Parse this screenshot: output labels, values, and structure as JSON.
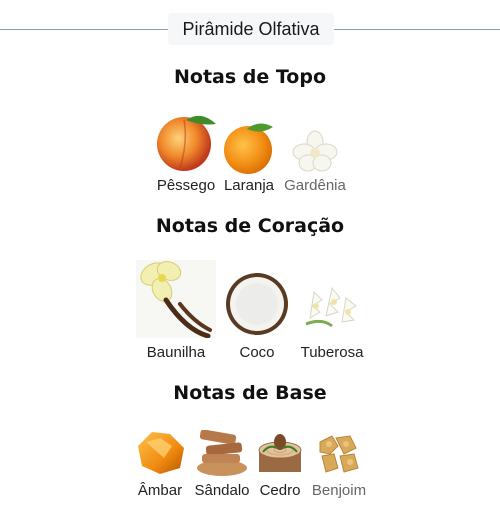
{
  "header": {
    "title": "Pirâmide Olfativa"
  },
  "sections": [
    {
      "title": "Notas de Topo",
      "notes": [
        {
          "label": "Pêssego",
          "icon": "peach-icon"
        },
        {
          "label": "Laranja",
          "icon": "orange-icon"
        },
        {
          "label": "Gardênia",
          "icon": "gardenia-icon"
        }
      ]
    },
    {
      "title": "Notas de Coração",
      "notes": [
        {
          "label": "Baunilha",
          "icon": "vanilla-icon"
        },
        {
          "label": "Coco",
          "icon": "coconut-icon"
        },
        {
          "label": "Tuberosa",
          "icon": "tuberose-icon"
        }
      ]
    },
    {
      "title": "Notas de Base",
      "notes": [
        {
          "label": "Âmbar",
          "icon": "amber-icon"
        },
        {
          "label": "Sândalo",
          "icon": "sandalwood-icon"
        },
        {
          "label": "Cedro",
          "icon": "cedar-icon"
        },
        {
          "label": "Benjoim",
          "icon": "benzoin-icon"
        }
      ]
    }
  ]
}
